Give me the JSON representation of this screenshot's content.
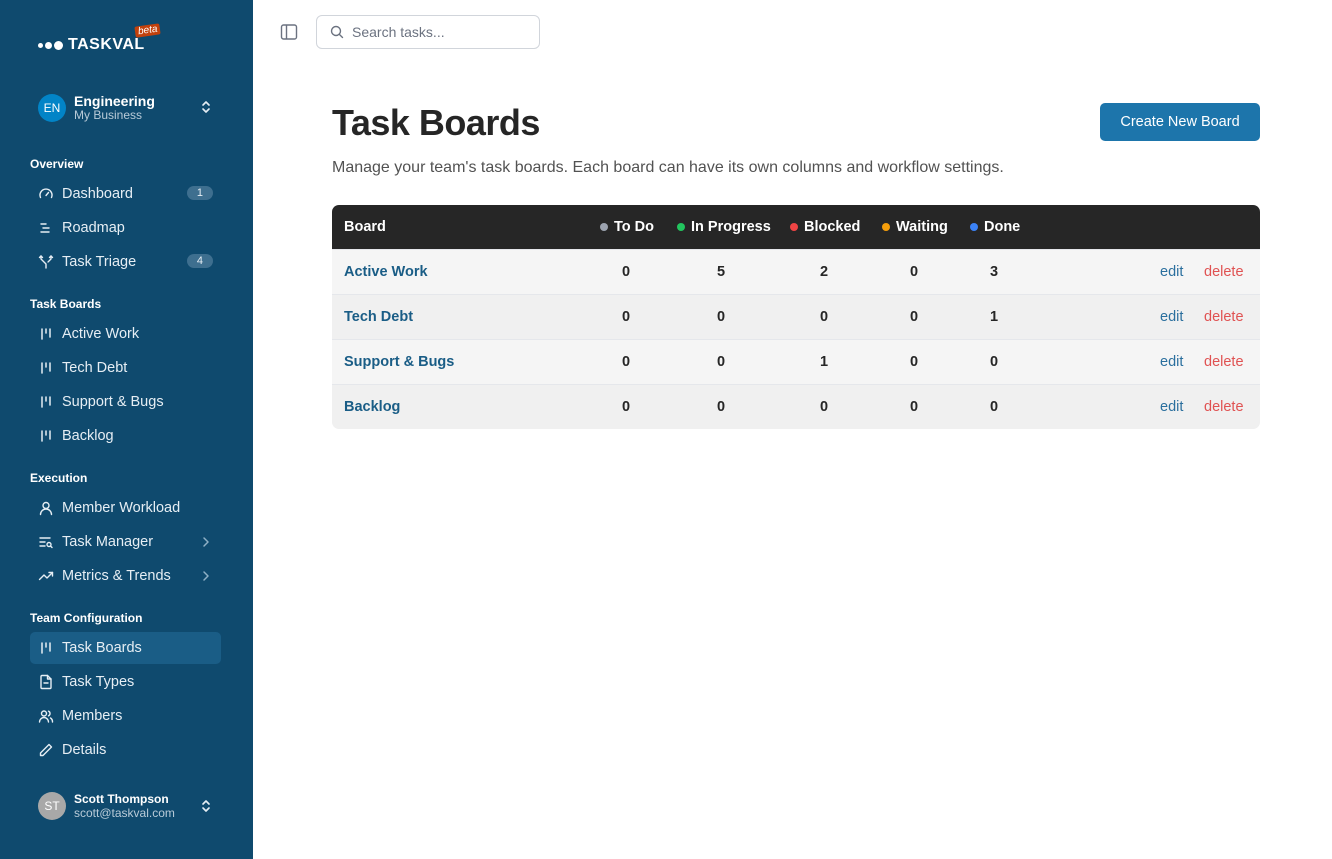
{
  "brand": {
    "name": "TASKVAL",
    "badge": "beta"
  },
  "workspace": {
    "initials": "EN",
    "name": "Engineering",
    "subtitle": "My Business"
  },
  "sidebar": {
    "sections": [
      {
        "title": "Overview",
        "items": [
          {
            "label": "Dashboard",
            "icon": "gauge-icon",
            "badge": "1"
          },
          {
            "label": "Roadmap",
            "icon": "roadmap-icon"
          },
          {
            "label": "Task Triage",
            "icon": "split-icon",
            "badge": "4"
          }
        ]
      },
      {
        "title": "Task Boards",
        "items": [
          {
            "label": "Active Work",
            "icon": "board-icon"
          },
          {
            "label": "Tech Debt",
            "icon": "board-icon"
          },
          {
            "label": "Support & Bugs",
            "icon": "board-icon"
          },
          {
            "label": "Backlog",
            "icon": "board-icon"
          }
        ]
      },
      {
        "title": "Execution",
        "items": [
          {
            "label": "Member Workload",
            "icon": "user-icon"
          },
          {
            "label": "Task Manager",
            "icon": "list-search-icon"
          },
          {
            "label": "Metrics & Trends",
            "icon": "trend-icon"
          }
        ]
      },
      {
        "title": "Team Configuration",
        "items": [
          {
            "label": "Task Boards",
            "icon": "board-icon",
            "active": true
          },
          {
            "label": "Task Types",
            "icon": "file-icon"
          },
          {
            "label": "Members",
            "icon": "users-icon"
          },
          {
            "label": "Details",
            "icon": "pencil-icon"
          }
        ]
      }
    ]
  },
  "user": {
    "initials": "ST",
    "name": "Scott Thompson",
    "email": "scott@taskval.com"
  },
  "search": {
    "placeholder": "Search tasks..."
  },
  "main": {
    "title": "Task Boards",
    "description": "Manage your team's task boards. Each board can have its own columns and workflow settings.",
    "create_button": "Create New Board"
  },
  "table": {
    "header_board": "Board",
    "columns": [
      {
        "label": "To Do",
        "color": "#9ca3af"
      },
      {
        "label": "In Progress",
        "color": "#22c55e"
      },
      {
        "label": "Blocked",
        "color": "#ef4444"
      },
      {
        "label": "Waiting",
        "color": "#f59e0b"
      },
      {
        "label": "Done",
        "color": "#3b82f6"
      }
    ],
    "rows": [
      {
        "board": "Active Work",
        "counts": [
          "0",
          "5",
          "2",
          "0",
          "3"
        ]
      },
      {
        "board": "Tech Debt",
        "counts": [
          "0",
          "0",
          "0",
          "0",
          "1"
        ]
      },
      {
        "board": "Support & Bugs",
        "counts": [
          "0",
          "0",
          "1",
          "0",
          "0"
        ]
      },
      {
        "board": "Backlog",
        "counts": [
          "0",
          "0",
          "0",
          "0",
          "0"
        ]
      }
    ],
    "edit_label": "edit",
    "delete_label": "delete"
  }
}
